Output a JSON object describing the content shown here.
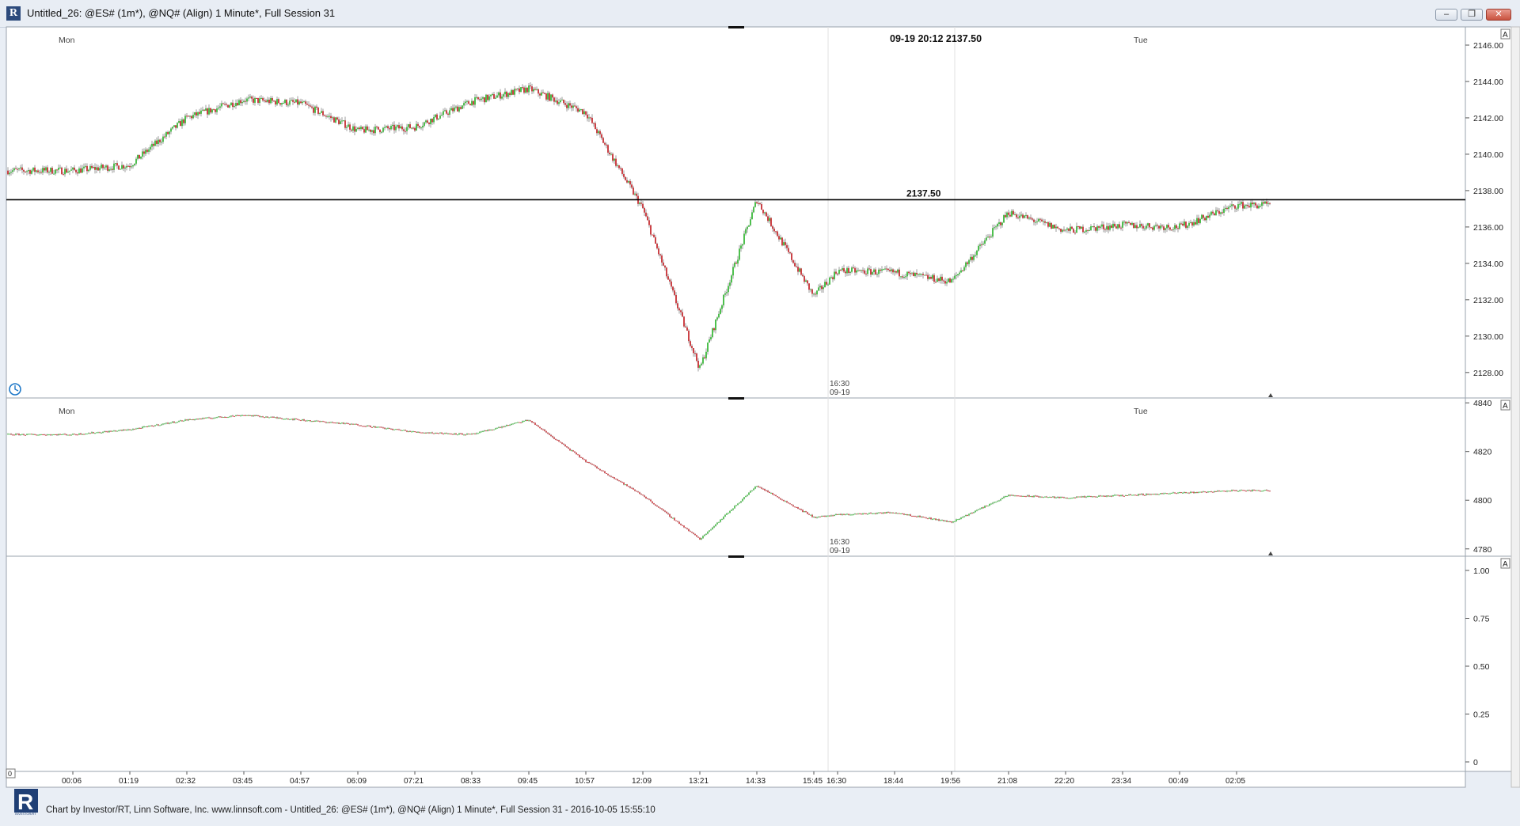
{
  "window": {
    "title": "Untitled_26: @ES# (1m*), @NQ# (Align) 1 Minute*, Full Session 31",
    "minimize_label": "–",
    "restore_label": "❐",
    "close_label": "✕"
  },
  "footer": {
    "text": "Chart by Investor/RT, Linn Software, Inc. www.linnsoft.com - Untitled_26: @ES# (1m*), @NQ# (Align) 1 Minute*, Full Session 31 - 2016-10-05 15:55:10"
  },
  "colors": {
    "up": "#22b022",
    "down": "#c0141a",
    "wick": "#1a1a1a",
    "grid": "#d8d8d8",
    "panel_bg": "#ffffff"
  },
  "chart_data": [
    {
      "type": "candlestick",
      "symbol": "@ES# (1m*)",
      "day_labels": [
        "Mon",
        "Tue"
      ],
      "y_ticks": [
        "2128.00",
        "2130.00",
        "2132.00",
        "2134.00",
        "2136.00",
        "2138.00",
        "2140.00",
        "2142.00",
        "2144.00",
        "2146.00"
      ],
      "ylim": [
        2126.6,
        2147.0
      ],
      "horizontal_line": {
        "value": 2137.5,
        "label": "2137.50"
      },
      "crosshair_readout": "09-19 20:12  2137.50",
      "session_marker": {
        "time": "16:30",
        "date": "09-19"
      },
      "corner_label": "A",
      "price_path": {
        "x": [
          "00:06",
          "01:19",
          "02:32",
          "03:45",
          "04:57",
          "06:09",
          "07:21",
          "08:33",
          "09:45",
          "10:57",
          "12:09",
          "13:21",
          "14:33",
          "15:45",
          "16:30",
          "18:44",
          "19:56",
          "21:08",
          "22:20",
          "23:34",
          "00:49",
          "02:05"
        ],
        "close": [
          2139.1,
          2139.4,
          2142.0,
          2143.0,
          2142.8,
          2141.3,
          2141.5,
          2142.9,
          2143.6,
          2142.3,
          2137.0,
          2128.2,
          2137.5,
          2132.2,
          2133.6,
          2133.5,
          2133.0,
          2136.8,
          2135.8,
          2136.1,
          2136.0,
          2137.2
        ]
      }
    },
    {
      "type": "candlestick",
      "symbol": "@NQ# (Align)",
      "day_labels": [
        "Mon",
        "Tue"
      ],
      "y_ticks": [
        "4780",
        "4800",
        "4820",
        "4840"
      ],
      "ylim": [
        4777,
        4842
      ],
      "session_marker": {
        "time": "16:30",
        "date": "09-19"
      },
      "corner_label": "A",
      "price_path": {
        "x": [
          "00:06",
          "01:19",
          "02:32",
          "03:45",
          "04:57",
          "06:09",
          "07:21",
          "08:33",
          "09:45",
          "10:57",
          "12:09",
          "13:21",
          "14:33",
          "15:45",
          "16:30",
          "18:44",
          "19:56",
          "21:08",
          "22:20",
          "23:34",
          "00:49",
          "02:05"
        ],
        "close": [
          4827,
          4829,
          4833,
          4835,
          4833,
          4831,
          4828,
          4827,
          4833,
          4816,
          4802,
          4784,
          4806,
          4793,
          4794,
          4795,
          4791,
          4802,
          4801,
          4802,
          4803,
          4804
        ]
      }
    },
    {
      "type": "line",
      "symbol": "",
      "y_ticks": [
        "0",
        "0.25",
        "0.50",
        "0.75",
        "1.00"
      ],
      "ylim": [
        0,
        1.0
      ],
      "corner_label": "A"
    }
  ],
  "x_axis": {
    "tick_labels": [
      "00:06",
      "01:19",
      "02:32",
      "03:45",
      "04:57",
      "06:09",
      "07:21",
      "08:33",
      "09:45",
      "10:57",
      "12:09",
      "13:21",
      "14:33",
      "15:45",
      "16:30",
      "18:44",
      "19:56",
      "21:08",
      "22:20",
      "23:34",
      "00:49",
      "02:05"
    ],
    "box_label": "0"
  }
}
